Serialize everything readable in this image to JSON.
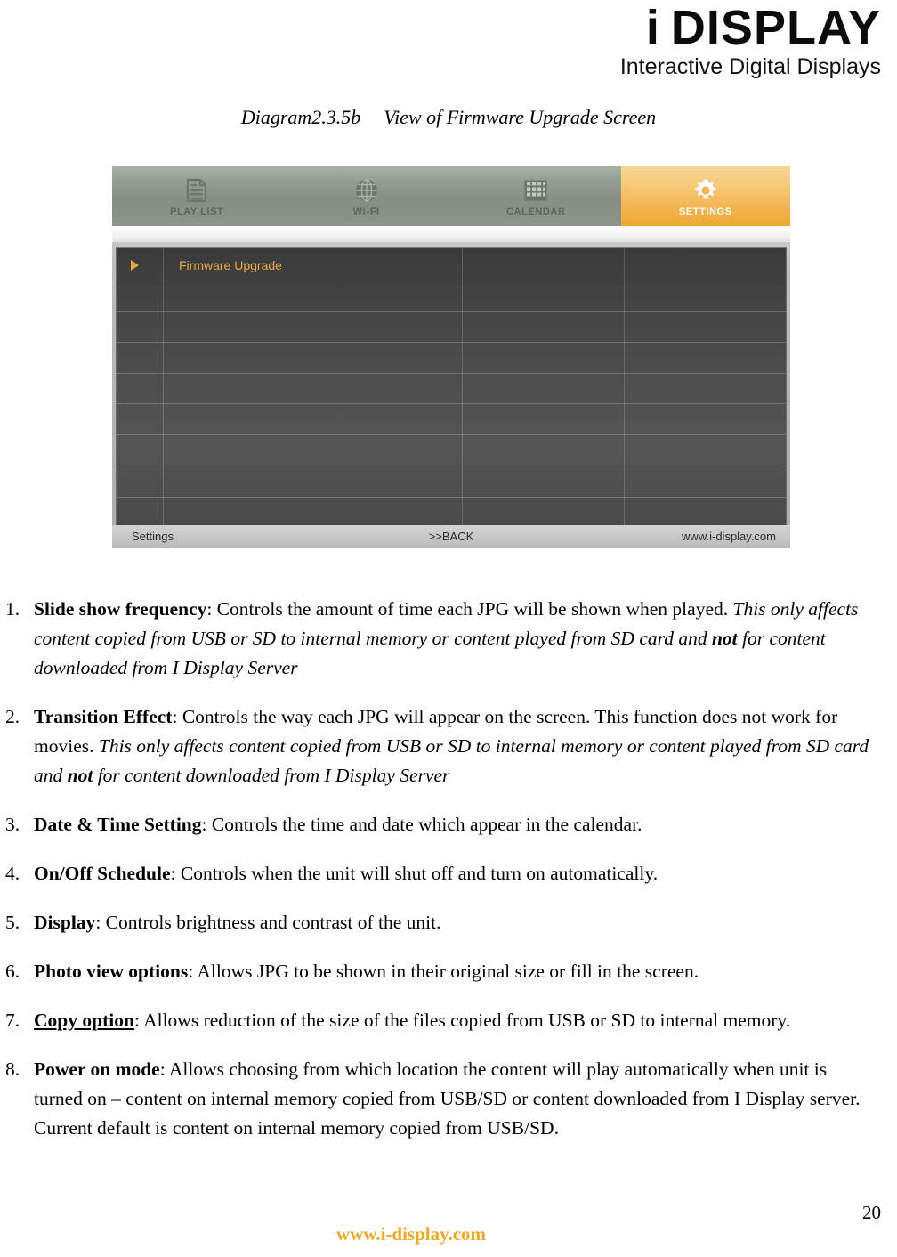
{
  "header": {
    "logo_prefix": "i",
    "logo_main": "DISPLAY",
    "logo_sub": "Interactive Digital Displays"
  },
  "figure": {
    "caption_number": "Diagram2.3.5b",
    "caption_text": "View of Firmware Upgrade Screen"
  },
  "device_screen": {
    "tabs": [
      {
        "label": "PLAY LIST",
        "icon": "document-icon",
        "active": false
      },
      {
        "label": "WI-FI",
        "icon": "globe-icon",
        "active": false
      },
      {
        "label": "CALENDAR",
        "icon": "calendar-icon",
        "active": false
      },
      {
        "label": "SETTINGS",
        "icon": "gear-icon",
        "active": true
      }
    ],
    "active_tab_color": "#f3b350",
    "list_items": [
      {
        "label": "Firmware Upgrade",
        "selected": true,
        "color": "#eda93d"
      }
    ],
    "status_bar": {
      "left": "Settings",
      "center": ">>BACK",
      "right": "www.i-display.com"
    }
  },
  "notes": {
    "items": [
      {
        "number": "1.",
        "segments": [
          {
            "text": "Slide show frequency",
            "style": "bold"
          },
          {
            "text": ":   Controls the amount of time each JPG will be shown when played. ",
            "style": "normal"
          },
          {
            "text": "This only affects content copied from USB or SD to internal memory or content played from SD card and ",
            "style": "italic"
          },
          {
            "text": "not",
            "style": "bold-italic"
          },
          {
            "text": " for content downloaded from I Display Server",
            "style": "italic"
          }
        ]
      },
      {
        "number": "2.",
        "segments": [
          {
            "text": "Transition Effect",
            "style": "bold"
          },
          {
            "text": ": Controls the way each JPG will appear on the screen. This function does not work for movies. ",
            "style": "normal"
          },
          {
            "text": "This only affects content copied from USB or SD to internal memory or content played from SD card and ",
            "style": "italic"
          },
          {
            "text": "not",
            "style": "bold-italic"
          },
          {
            "text": " for content downloaded from I Display Server",
            "style": "italic"
          }
        ]
      },
      {
        "number": "3.",
        "segments": [
          {
            "text": "Date & Time Setting",
            "style": "bold"
          },
          {
            "text": ": Controls the time and date which appear in the calendar.",
            "style": "normal"
          }
        ]
      },
      {
        "number": "4.",
        "segments": [
          {
            "text": "On/Off Schedule",
            "style": "bold"
          },
          {
            "text": ": Controls when the unit will shut off and turn on automatically.",
            "style": "normal"
          }
        ]
      },
      {
        "number": "5.",
        "segments": [
          {
            "text": "Display",
            "style": "bold"
          },
          {
            "text": ": Controls brightness and contrast of the unit.",
            "style": "normal"
          }
        ]
      },
      {
        "number": "6.",
        "segments": [
          {
            "text": "Photo view options",
            "style": "bold"
          },
          {
            "text": ": Allows JPG to be shown in their original size or fill in the screen.",
            "style": "normal"
          }
        ]
      },
      {
        "number": "7.",
        "segments": [
          {
            "text": "Copy option",
            "style": "bold-underline"
          },
          {
            "text": ": Allows reduction of the size of the files copied from USB or SD to internal memory.",
            "style": "normal"
          }
        ]
      },
      {
        "number": "8.",
        "segments": [
          {
            "text": "Power on mode",
            "style": "bold"
          },
          {
            "text": ": Allows choosing from which location the content will play automatically when unit is turned on – content on internal memory copied from USB/SD or content downloaded from I Display server. Current default is content on internal memory copied from USB/SD.",
            "style": "normal"
          }
        ]
      }
    ]
  },
  "footer": {
    "website": "www.i-display.com",
    "website_color": "#f2a81d",
    "page_number": "20"
  }
}
